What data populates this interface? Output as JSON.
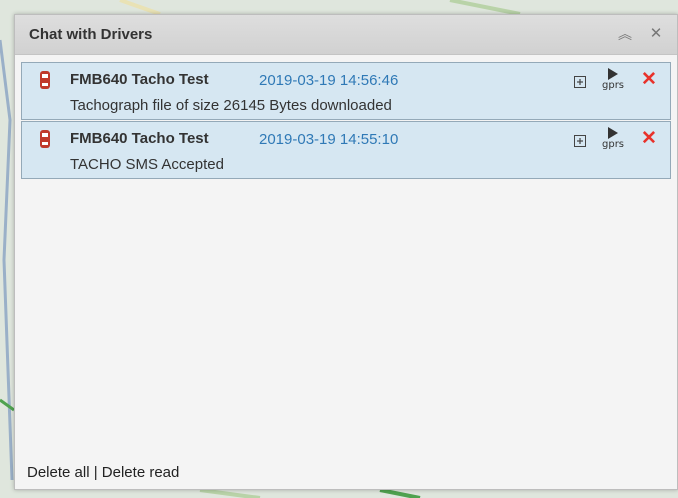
{
  "panel": {
    "title": "Chat with Drivers",
    "collapse_icon": "double-chevron-up-icon",
    "close_icon": "close-icon"
  },
  "messages": [
    {
      "sender": "FMB640 Tacho Test",
      "timestamp": "2019-03-19 14:56:46",
      "text": "Tachograph file of size 26145 Bytes downloaded",
      "gprs_label": "gprs"
    },
    {
      "sender": "FMB640 Tacho Test",
      "timestamp": "2019-03-19 14:55:10",
      "text": "TACHO SMS Accepted",
      "gprs_label": "gprs"
    }
  ],
  "footer": {
    "delete_all": "Delete all",
    "separator": "|",
    "delete_read": "Delete read"
  },
  "colors": {
    "message_bg": "#d6e7f2",
    "timestamp": "#2f79b6",
    "delete_icon": "#e8322b",
    "car_icon": "#c0392b"
  }
}
